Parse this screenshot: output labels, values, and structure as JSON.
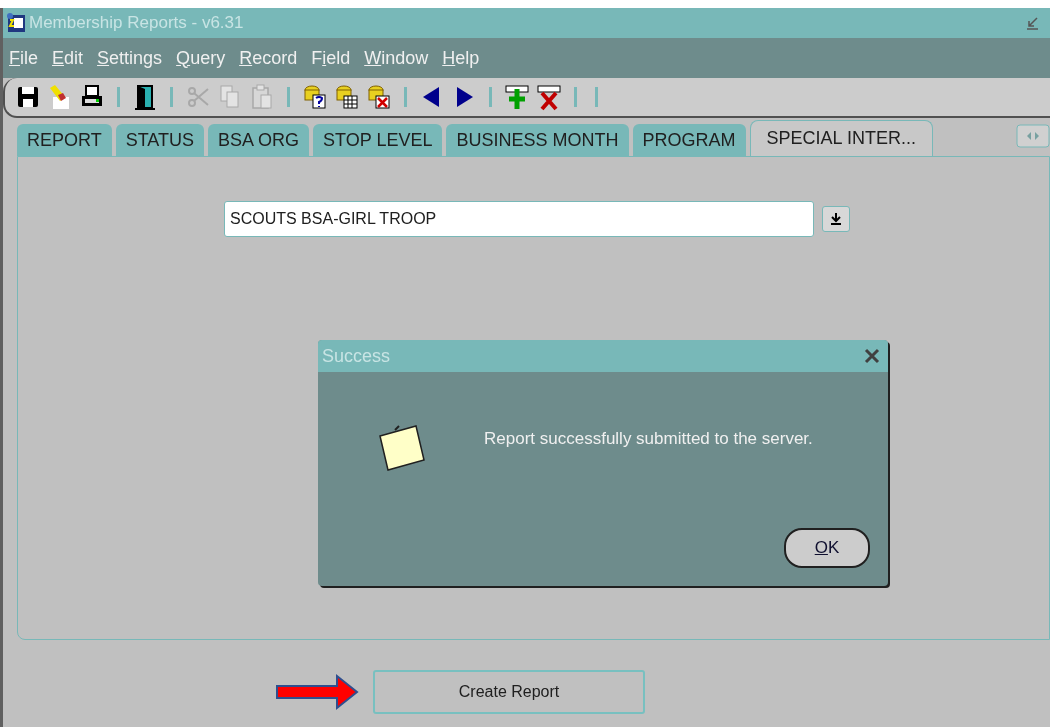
{
  "window": {
    "title": "Membership Reports - v6.31"
  },
  "menu": [
    {
      "key": "F",
      "after": "ile"
    },
    {
      "key": "E",
      "after": "dit"
    },
    {
      "key": "S",
      "after": "ettings"
    },
    {
      "key": "Q",
      "after": "uery"
    },
    {
      "key": "R",
      "after": "ecord"
    },
    {
      "before": "F",
      "key": "i",
      "after": "eld"
    },
    {
      "key": "W",
      "after": "indow"
    },
    {
      "key": "H",
      "after": "elp"
    }
  ],
  "toolbar": [
    {
      "kind": "save",
      "disabled": false
    },
    {
      "kind": "clear",
      "disabled": false
    },
    {
      "kind": "print",
      "disabled": false
    },
    {
      "kind": "sep"
    },
    {
      "kind": "exit",
      "disabled": false
    },
    {
      "kind": "sep"
    },
    {
      "kind": "cut",
      "disabled": true
    },
    {
      "kind": "copy",
      "disabled": true
    },
    {
      "kind": "paste",
      "disabled": true
    },
    {
      "kind": "sep"
    },
    {
      "kind": "query",
      "disabled": false
    },
    {
      "kind": "execute",
      "disabled": false
    },
    {
      "kind": "cancel",
      "disabled": false
    },
    {
      "kind": "sep"
    },
    {
      "kind": "prev",
      "disabled": false
    },
    {
      "kind": "next",
      "disabled": false
    },
    {
      "kind": "sep"
    },
    {
      "kind": "insert",
      "disabled": false
    },
    {
      "kind": "delete",
      "disabled": false
    },
    {
      "kind": "sep"
    },
    {
      "kind": "sep"
    }
  ],
  "tabs": [
    {
      "label": "REPORT",
      "selected": false
    },
    {
      "label": "STATUS",
      "selected": false
    },
    {
      "label": "BSA ORG",
      "selected": false
    },
    {
      "label": "STOP LEVEL",
      "selected": false
    },
    {
      "label": "BUSINESS MONTH",
      "selected": false
    },
    {
      "label": "PROGRAM",
      "selected": false
    },
    {
      "label": "SPECIAL INTER...",
      "selected": true
    }
  ],
  "field": {
    "value": "SCOUTS BSA-GIRL TROOP"
  },
  "dialog": {
    "title": "Success",
    "message": "Report successfully submitted to the server.",
    "ok": {
      "key": "O",
      "after": "K"
    }
  },
  "create_button": {
    "label": "Create Report"
  }
}
